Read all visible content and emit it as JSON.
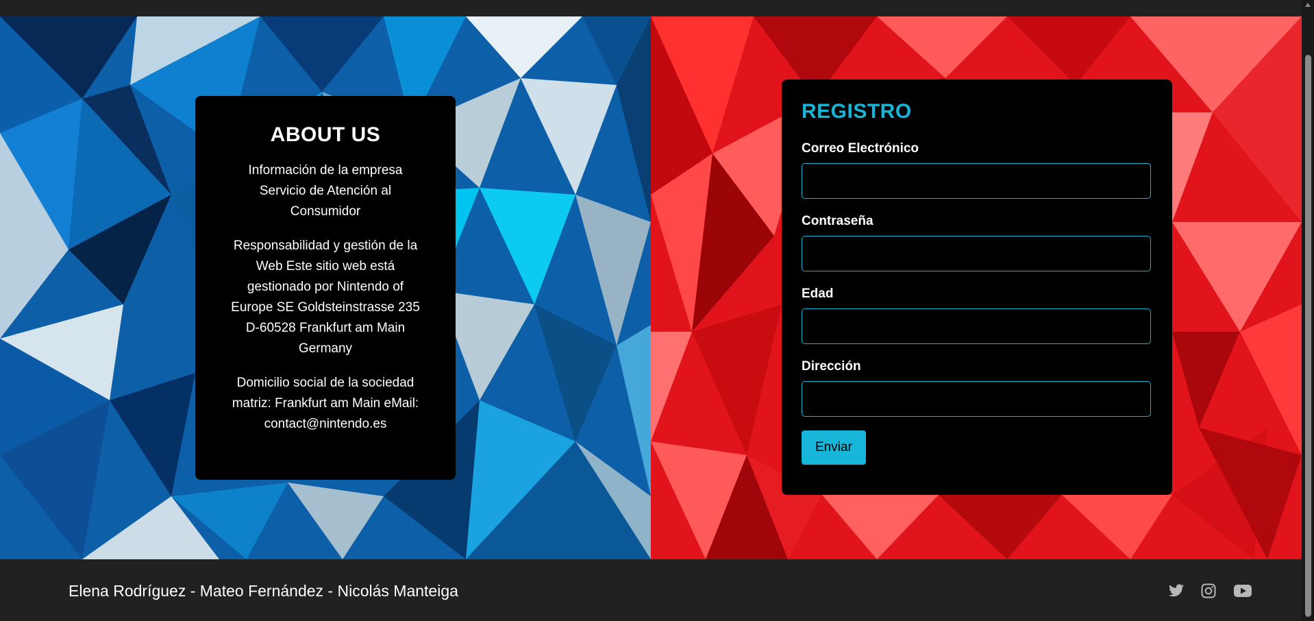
{
  "about": {
    "title": "ABOUT US",
    "paragraphs": [
      "Información de la empresa Servicio de Atención al Consumidor",
      "Responsabilidad y gestión de la Web Este sitio web está gestionado por Nintendo of Europe SE Goldsteinstrasse 235 D-60528 Frankfurt am Main Germany",
      "Domicilio social de la sociedad matriz: Frankfurt am Main eMail: contact@nintendo.es"
    ]
  },
  "form": {
    "title": "REGISTRO",
    "fields": [
      {
        "label": "Correo Electrónico",
        "value": ""
      },
      {
        "label": "Contraseña",
        "value": ""
      },
      {
        "label": "Edad",
        "value": ""
      },
      {
        "label": "Dirección",
        "value": ""
      }
    ],
    "submit_label": "Enviar"
  },
  "footer": {
    "authors": "Elena Rodríguez - Mateo Fernández - Nicolás Manteiga",
    "social_icons": [
      "twitter-icon",
      "instagram-icon",
      "youtube-icon"
    ]
  },
  "colors": {
    "accent": "#17b5d8",
    "card_background": "#000000",
    "page_background": "#212121"
  }
}
